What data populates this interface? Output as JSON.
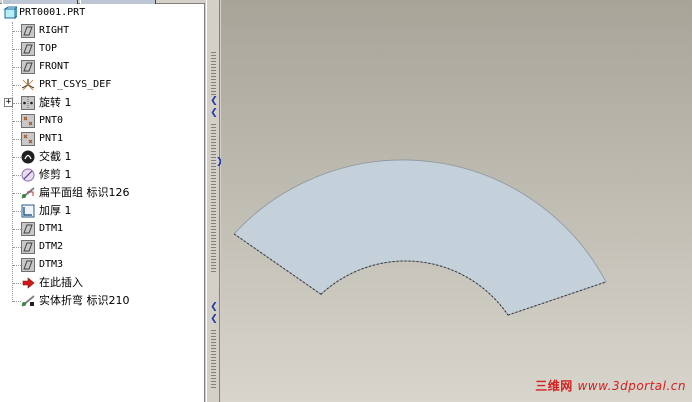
{
  "model_tree": {
    "root": {
      "label": "PRT0001.PRT",
      "icon": "part-icon"
    },
    "items": [
      {
        "label": "RIGHT",
        "icon": "datum-plane-icon"
      },
      {
        "label": "TOP",
        "icon": "datum-plane-icon"
      },
      {
        "label": "FRONT",
        "icon": "datum-plane-icon"
      },
      {
        "label": "PRT_CSYS_DEF",
        "icon": "coordinate-system-icon"
      },
      {
        "label": "旋转 1",
        "icon": "revolve-icon"
      },
      {
        "label": "PNT0",
        "icon": "datum-point-icon"
      },
      {
        "label": "PNT1",
        "icon": "datum-point-icon"
      },
      {
        "label": "交截 1",
        "icon": "intersect-icon"
      },
      {
        "label": "修剪 1",
        "icon": "trim-icon"
      },
      {
        "label": "扁平面组 标识126",
        "icon": "flatten-quilt-icon"
      },
      {
        "label": "加厚 1",
        "icon": "thicken-icon"
      },
      {
        "label": "DTM1",
        "icon": "datum-plane-icon"
      },
      {
        "label": "DTM2",
        "icon": "datum-plane-icon"
      },
      {
        "label": "DTM3",
        "icon": "datum-plane-icon"
      },
      {
        "label": "在此插入",
        "icon": "insert-here-arrow-icon"
      },
      {
        "label": "实体折弯 标识210",
        "icon": "solid-bend-icon"
      }
    ]
  },
  "colors": {
    "tree_bg": "#ffffff",
    "frame": "#d4d0c8",
    "part_fill": "#c4d0da",
    "splitter_arrow": "#1a3aa6",
    "watermark": "#d42020"
  },
  "watermark": {
    "site_name": "三维网",
    "url": "www.3dportal.cn"
  }
}
